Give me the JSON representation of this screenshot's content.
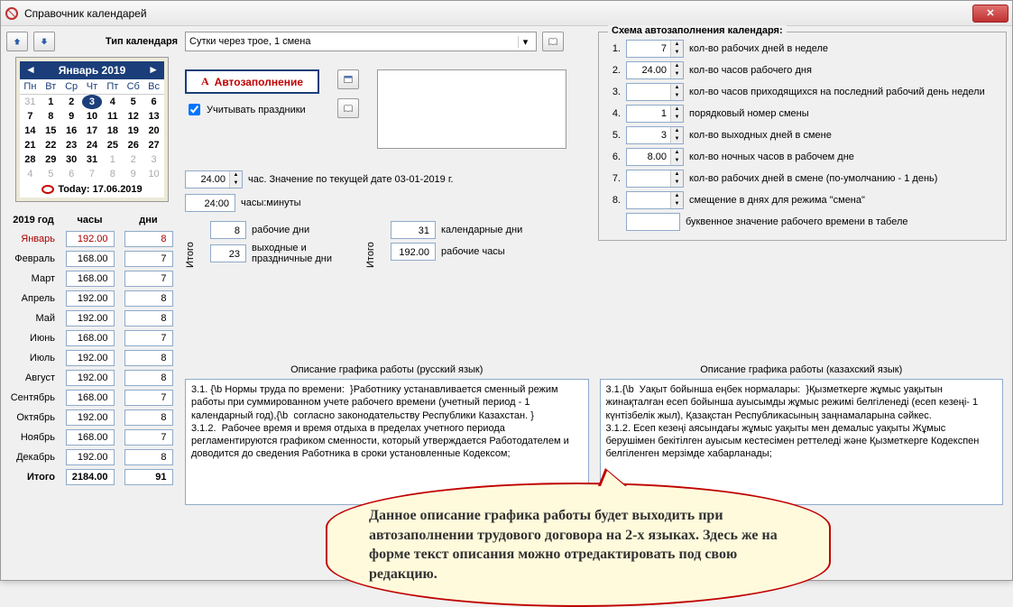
{
  "window": {
    "title": "Справочник календарей"
  },
  "type_label": "Тип календаря",
  "type_value": "Сутки через трое, 1 смена",
  "autofill_btn": "Автозаполнение",
  "holidays_check": "Учитывать праздники",
  "hours_row": {
    "value": "24.00",
    "label": "час. Значение по текущей дате 03-01-2019 г."
  },
  "hm_row": {
    "value": "24:00",
    "label": "часы:минуты"
  },
  "calendar": {
    "month": "Январь 2019",
    "dow": [
      "Пн",
      "Вт",
      "Ср",
      "Чт",
      "Пт",
      "Сб",
      "Вс"
    ],
    "selected_day": "3",
    "today_label": "Today: 17.06.2019",
    "prev_tail": [
      "31"
    ],
    "days": [
      "1",
      "2",
      "3",
      "4",
      "5",
      "6",
      "7",
      "8",
      "9",
      "10",
      "11",
      "12",
      "13",
      "14",
      "15",
      "16",
      "17",
      "18",
      "19",
      "20",
      "21",
      "22",
      "23",
      "24",
      "25",
      "26",
      "27",
      "28",
      "29",
      "30",
      "31"
    ],
    "next_head": [
      "1",
      "2",
      "3",
      "4",
      "5",
      "6",
      "7",
      "8",
      "9",
      "10"
    ]
  },
  "year_label": "2019 год",
  "col_hours": "часы",
  "col_days": "дни",
  "months": [
    {
      "name": "Январь",
      "hours": "192.00",
      "days": "8",
      "sel": true
    },
    {
      "name": "Февраль",
      "hours": "168.00",
      "days": "7"
    },
    {
      "name": "Март",
      "hours": "168.00",
      "days": "7"
    },
    {
      "name": "Апрель",
      "hours": "192.00",
      "days": "8"
    },
    {
      "name": "Май",
      "hours": "192.00",
      "days": "8"
    },
    {
      "name": "Июнь",
      "hours": "168.00",
      "days": "7"
    },
    {
      "name": "Июль",
      "hours": "192.00",
      "days": "8"
    },
    {
      "name": "Август",
      "hours": "192.00",
      "days": "8"
    },
    {
      "name": "Сентябрь",
      "hours": "168.00",
      "days": "7"
    },
    {
      "name": "Октябрь",
      "hours": "192.00",
      "days": "8"
    },
    {
      "name": "Ноябрь",
      "hours": "168.00",
      "days": "7"
    },
    {
      "name": "Декабрь",
      "hours": "192.00",
      "days": "8"
    }
  ],
  "totals": {
    "label": "Итого",
    "hours": "2184.00",
    "days": "91"
  },
  "itogo": {
    "label": "Итого",
    "work_days": {
      "value": "8",
      "label": "рабочие дни"
    },
    "off_days": {
      "value": "23",
      "label": "выходные и праздничные дни"
    },
    "cal_days": {
      "value": "31",
      "label": "календарные дни"
    },
    "work_hours": {
      "value": "192.00",
      "label": "рабочие часы"
    }
  },
  "scheme": {
    "title": "Схема автозаполнения календаря:",
    "rows": [
      {
        "n": "1.",
        "v": "7",
        "lbl": "кол-во рабочих дней в неделе"
      },
      {
        "n": "2.",
        "v": "24.00",
        "lbl": "кол-во часов рабочего дня"
      },
      {
        "n": "3.",
        "v": "",
        "lbl": "кол-во часов приходящихся на последний рабочий день недели"
      },
      {
        "n": "4.",
        "v": "1",
        "lbl": "порядковый номер смены"
      },
      {
        "n": "5.",
        "v": "3",
        "lbl": "кол-во выходных дней в смене"
      },
      {
        "n": "6.",
        "v": "8.00",
        "lbl": "кол-во ночных часов в рабочем дне"
      },
      {
        "n": "7.",
        "v": "",
        "lbl": "кол-во рабочих дней в смене (по-умолчанию - 1 день)"
      },
      {
        "n": "8.",
        "v": "",
        "lbl": "смещение в днях для режима \"смена\""
      }
    ],
    "letter": {
      "v": "",
      "lbl": "буквенное значение рабочего времени в табеле"
    }
  },
  "desc_ru_title": "Описание графика работы (русский язык)",
  "desc_kz_title": "Описание графика работы (казахский язык)",
  "desc_ru": "3.1. {\\b Нормы труда по времени:  }Работнику устанавливается сменный режим работы при суммированном учете рабочего времени (учетный период - 1 календарный год),{\\b  согласно законодательству Республики Казахстан. }\n3.1.2.  Рабочее время и время отдыха в пределах учетного периода регламентируются графиком сменности, который утверждается Работодателем и доводится до сведения Работника в сроки установленные Кодексом;",
  "desc_kz": "3.1.{\\b  Уақыт бойынша еңбек нормалары:  }Қызметкерге жұмыс уақытын жинақталған есеп бойынша ауысымды жұмыс режимі белгіленеді (есеп кезеңі- 1 күнтізбелік жыл), Қазақстан Республикасының заңнамаларына сәйкес.\n3.1.2. Есеп кезеңі аясындағы жұмыс уақыты мен демалыс уақыты Жұмыс берушімен бекітілген ауысым кестесімен реттеледі және Қызметкерге Кодекспен белгіленген мерзімде хабарланады;",
  "callout": "Данное описание графика работы будет выходить при автозаполнении трудового договора на 2-х языках. Здесь же на форме текст описания можно отредактировать под свою редакцию."
}
